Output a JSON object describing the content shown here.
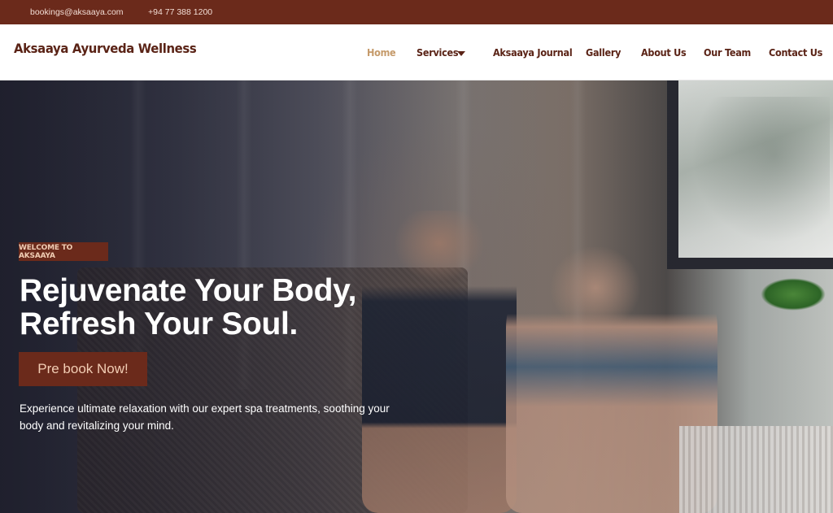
{
  "topbar": {
    "email": "bookings@aksaaya.com",
    "phone": "+94 77 388 1200"
  },
  "header": {
    "brand": "Aksaaya Ayurveda Wellness",
    "nav": [
      {
        "label": "Home",
        "active": true
      },
      {
        "label": "Services",
        "has_dropdown": true
      },
      {
        "label": "Aksaaya Journal"
      },
      {
        "label": "Gallery"
      },
      {
        "label": "About Us"
      },
      {
        "label": "Our Team"
      },
      {
        "label": "Contact Us"
      }
    ]
  },
  "hero": {
    "badge": "WELCOME TO AKSAAYA",
    "headline_line1": "Rejuvenate Your Body,",
    "headline_line2": "Refresh Your Soul.",
    "cta_label": "Pre book Now!",
    "description_line1": "Experience ultimate relaxation with our expert spa treatments, soothing your",
    "description_line2": "body and revitalizing your mind."
  },
  "colors": {
    "brand_dark": "#6b2a1b",
    "nav_text": "#5a2316",
    "nav_active": "#c59a6a"
  },
  "icons": {
    "services_dropdown": "chevron-down-icon"
  }
}
